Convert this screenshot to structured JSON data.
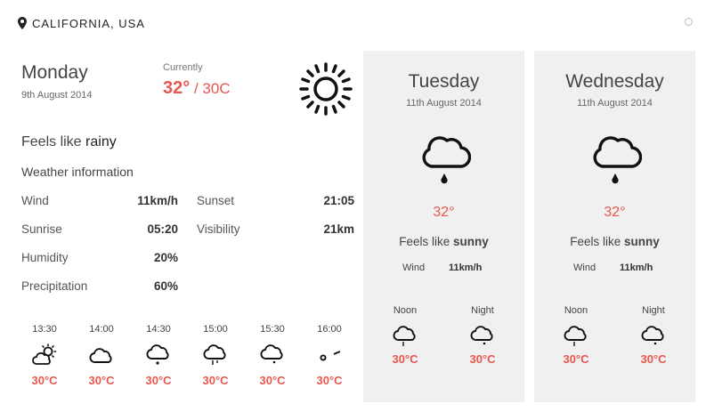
{
  "header": {
    "location": "CALIFORNIA, USA",
    "location_icon": "map-pin-icon"
  },
  "today": {
    "day": "Monday",
    "date": "9th August 2014",
    "currently_label": "Currently",
    "temp_main": "32°",
    "temp_alt": " / 30C",
    "icon": "sun-icon",
    "feels_prefix": "Feels like ",
    "feels_value": "rainy",
    "info_title": "Weather information",
    "info": [
      {
        "label": "Wind",
        "value": "11km/h",
        "label2": "Sunset",
        "value2": "21:05"
      },
      {
        "label": "Sunrise",
        "value": "05:20",
        "label2": "Visibility",
        "value2": "21km"
      },
      {
        "label": "Humidity",
        "value": "20%",
        "label2": "",
        "value2": ""
      },
      {
        "label": "Precipitation",
        "value": "60%",
        "label2": "",
        "value2": ""
      }
    ],
    "hourly": [
      {
        "time": "13:30",
        "icon": "partly-sunny-icon",
        "temp": "30°C"
      },
      {
        "time": "14:00",
        "icon": "cloud-icon",
        "temp": "30°C"
      },
      {
        "time": "14:30",
        "icon": "cloud-drizzle-icon",
        "temp": "30°C"
      },
      {
        "time": "15:00",
        "icon": "cloud-rain-icon",
        "temp": "30°C"
      },
      {
        "time": "15:30",
        "icon": "cloud-drizzle-icon",
        "temp": "30°C"
      },
      {
        "time": "16:00",
        "icon": "wind-icon",
        "temp": "30°C"
      }
    ]
  },
  "forecast": [
    {
      "day": "Tuesday",
      "date": "11th August 2014",
      "icon": "cloud-drizzle-icon",
      "temp": "32°",
      "feels_prefix": "Feels like ",
      "feels_value": "sunny",
      "wind_label": "Wind",
      "wind_value": "11km/h",
      "noon_label": "Noon",
      "noon_temp": "30°C",
      "night_label": "Night",
      "night_temp": "30°C"
    },
    {
      "day": "Wednesday",
      "date": "11th August 2014",
      "icon": "cloud-drizzle-icon",
      "temp": "32°",
      "feels_prefix": "Feels like ",
      "feels_value": "sunny",
      "wind_label": "Wind",
      "wind_value": "11km/h",
      "noon_label": "Noon",
      "noon_temp": "30°C",
      "night_label": "Night",
      "night_temp": "30°C"
    }
  ],
  "colors": {
    "accent": "#e8574e",
    "card_bg": "#f0f0f0"
  }
}
